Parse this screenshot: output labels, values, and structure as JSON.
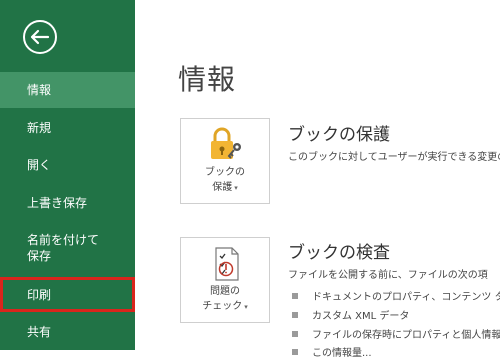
{
  "sidebar": {
    "items": [
      {
        "label": "情報"
      },
      {
        "label": "新規"
      },
      {
        "label": "開く"
      },
      {
        "label": "上書き保存"
      },
      {
        "label": "名前を付けて\n保存"
      },
      {
        "label": "印刷"
      },
      {
        "label": "共有"
      }
    ]
  },
  "main": {
    "title": "情報",
    "protect": {
      "tile_line1": "ブックの",
      "tile_line2": "保護",
      "heading": "ブックの保護",
      "description": "このブックに対してユーザーが実行できる変更の"
    },
    "inspect": {
      "tile_line1": "問題の",
      "tile_line2": "チェック",
      "heading": "ブックの検査",
      "description": "ファイルを公開する前に、ファイルの次の項",
      "bullets": [
        "ドキュメントのプロパティ、コンテンツ タイプ",
        "カスタム XML データ",
        "ファイルの保存時にプロパティと個人情報",
        "この情報量..."
      ]
    }
  },
  "colors": {
    "sidebar_bg": "#217346",
    "selected_bg": "#439467",
    "highlight_border": "#d9251c"
  }
}
